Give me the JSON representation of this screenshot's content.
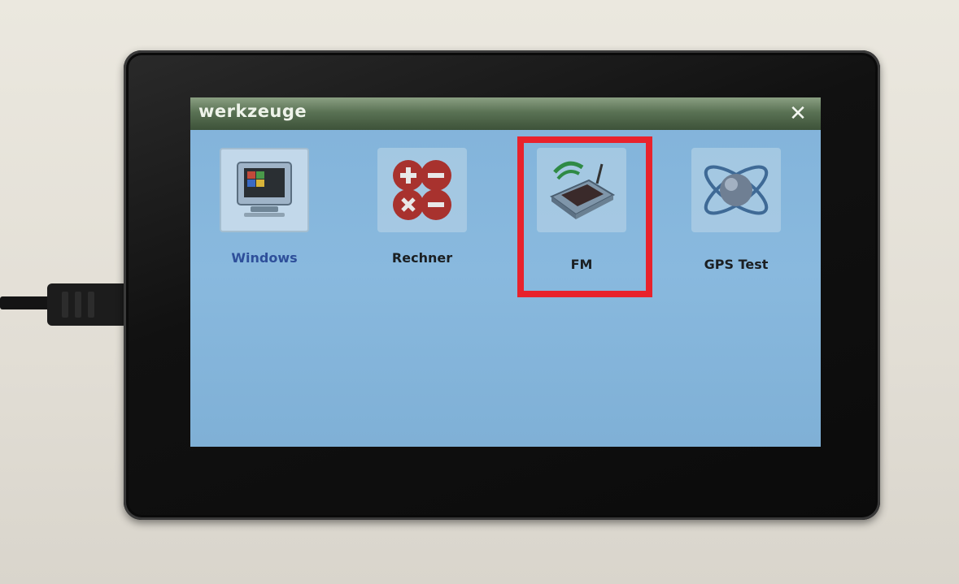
{
  "window": {
    "title": "werkzeuge",
    "close_glyph": "✕"
  },
  "apps": [
    {
      "label": "Windows",
      "icon": "monitor-icon",
      "selected": true
    },
    {
      "label": "Rechner",
      "icon": "calculator-icon",
      "selected": false
    },
    {
      "label": "FM",
      "icon": "fm-radio-icon",
      "selected": false
    },
    {
      "label": "GPS Test",
      "icon": "globe-orbit-icon",
      "selected": false
    }
  ],
  "highlight": {
    "target": "FM",
    "color": "#e8222c"
  },
  "colors": {
    "screen": "#85b6dc",
    "titlebar": "#5a7254",
    "selected_label": "#2e4f9a"
  }
}
